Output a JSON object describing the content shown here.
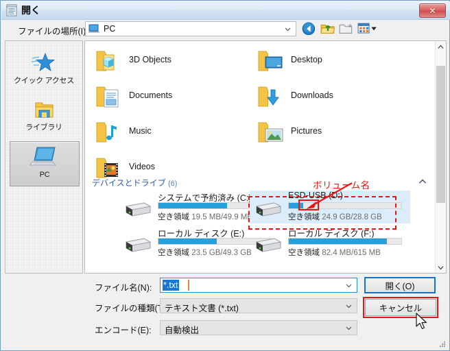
{
  "window": {
    "title": "開く",
    "title_icon": "notepad-icon",
    "close_label": "✕"
  },
  "nav": {
    "location_label": "ファイルの場所(I):",
    "location_value": "PC",
    "location_icon": "monitor-icon",
    "buttons": [
      {
        "name": "back-button",
        "icon": "back-arrow-icon",
        "label": ""
      },
      {
        "name": "up-one-level-button",
        "icon": "up-folder-icon",
        "label": ""
      },
      {
        "name": "new-folder-button",
        "icon": "new-folder-icon",
        "label": ""
      },
      {
        "name": "views-button",
        "icon": "views-icon",
        "label": ""
      }
    ]
  },
  "sidebar": {
    "items": [
      {
        "label": "クイック アクセス",
        "icon": "star-icon",
        "selected": false
      },
      {
        "label": "ライブラリ",
        "icon": "library-folder-icon",
        "selected": false
      },
      {
        "label": "PC",
        "icon": "computer-icon",
        "selected": true
      }
    ]
  },
  "folders": [
    {
      "label": "3D Objects",
      "icon": "3d-objects-folder-icon"
    },
    {
      "label": "Desktop",
      "icon": "desktop-folder-icon"
    },
    {
      "label": "Documents",
      "icon": "documents-folder-icon"
    },
    {
      "label": "Downloads",
      "icon": "downloads-folder-icon"
    },
    {
      "label": "Music",
      "icon": "music-folder-icon"
    },
    {
      "label": "Pictures",
      "icon": "pictures-folder-icon"
    },
    {
      "label": "Videos",
      "icon": "videos-folder-icon"
    }
  ],
  "group": {
    "title": "デバイスとドライブ",
    "count": "(6)",
    "collapse_icon": "chevron-up-icon"
  },
  "drives": [
    {
      "name": "システムで予約済み",
      "letter": "(C:)",
      "free_label": "空き領域",
      "free_value": "19.5 MB/49.9 MB",
      "used_percent": 61,
      "selected": false
    },
    {
      "name": "ESD-USB",
      "letter": "(D:)",
      "free_label": "空き領域",
      "free_value": "24.9 GB/28.8 GB",
      "used_percent": 13,
      "selected": true
    },
    {
      "name": "ローカル ディスク",
      "letter": "(E:)",
      "free_label": "空き領域",
      "free_value": "23.5 GB/49.3 GB",
      "used_percent": 52,
      "selected": false
    },
    {
      "name": "ローカル ディスク",
      "letter": "(F:)",
      "free_label": "空き領域",
      "free_value": "82.4 MB/615 MB",
      "used_percent": 87,
      "selected": false
    }
  ],
  "annotation": {
    "text": "ボリューム名",
    "color": "#ee1111"
  },
  "form": {
    "filename_label": "ファイル名(N):",
    "filename_value": "*.txt",
    "filetype_label": "ファイルの種類(T):",
    "filetype_value": "テキスト文書 (*.txt)",
    "encoding_label": "エンコード(E):",
    "encoding_value": "自動検出"
  },
  "buttons": {
    "open_label": "開く(O)",
    "cancel_label": "キャンセル"
  },
  "colors": {
    "accent_blue": "#26a0da",
    "selection_blue": "#1877d2",
    "annotation_red": "#ee1111",
    "group_header_blue": "#2b5aa8"
  }
}
